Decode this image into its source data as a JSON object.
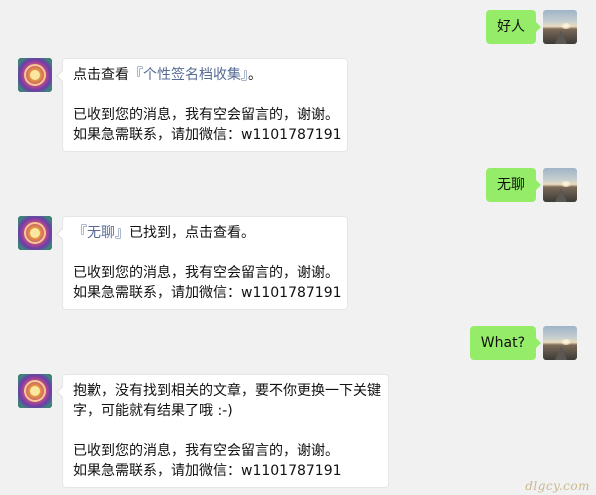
{
  "messages": [
    {
      "sender": "user",
      "text": "好人"
    },
    {
      "sender": "bot",
      "intro_prefix": "点击查看",
      "intro_link": "『个性签名档收集』",
      "intro_suffix": "。",
      "reply_line1": "已收到您的消息，我有空会留言的，谢谢。",
      "reply_line2": "如果急需联系，请加微信：w1101787191"
    },
    {
      "sender": "user",
      "text": "无聊"
    },
    {
      "sender": "bot",
      "intro_link": "『无聊』",
      "intro_suffix": "已找到，点击查看。",
      "reply_line1": "已收到您的消息，我有空会留言的，谢谢。",
      "reply_line2": "如果急需联系，请加微信：w1101787191"
    },
    {
      "sender": "user",
      "text": "What?"
    },
    {
      "sender": "bot",
      "apology_line1": "抱歉，没有找到相关的文章，要不你更换一下关键",
      "apology_line2": "字，可能就有结果了哦 :-)",
      "reply_line1": "已收到您的消息，我有空会留言的，谢谢。",
      "reply_line2": "如果急需联系，请加微信：w1101787191"
    }
  ],
  "watermark": "dlgcy.com",
  "colors": {
    "background": "#f1f1f1",
    "user_bubble": "#95ec69",
    "bot_bubble": "#ffffff",
    "link": "#576b95"
  },
  "icons": {
    "user_avatar": "sunset-road-avatar-icon",
    "bot_avatar": "mandala-avatar-icon"
  }
}
